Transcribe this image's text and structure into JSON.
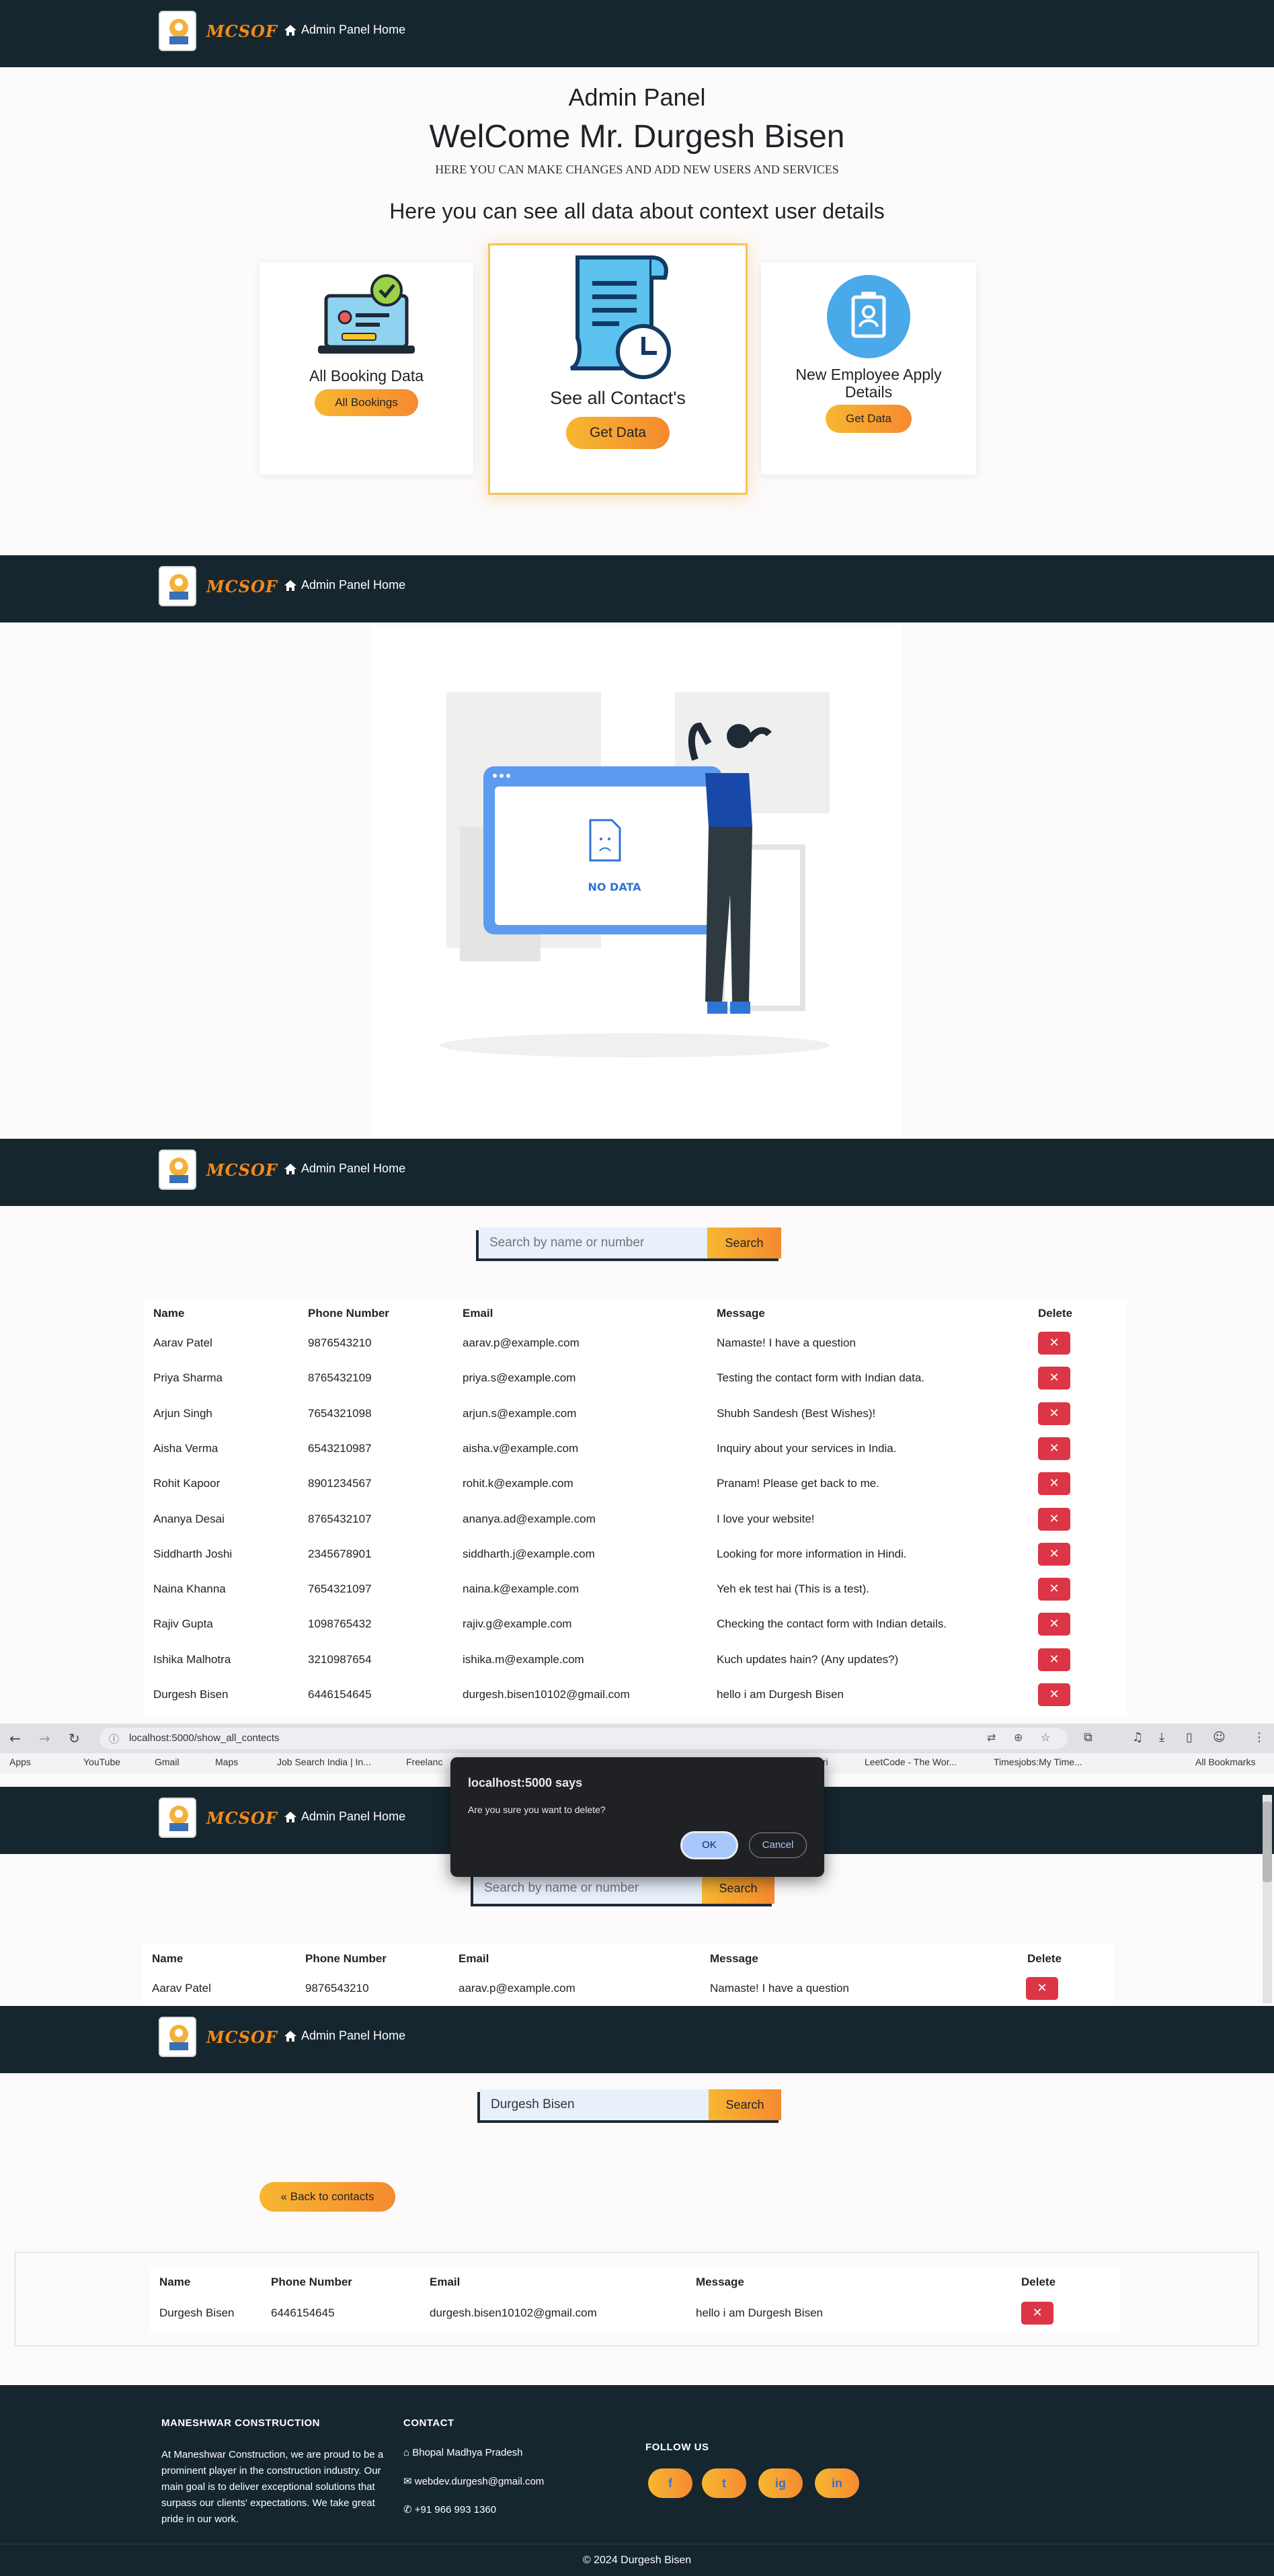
{
  "brand": "MCSOF",
  "nav_home": "Admin Panel Home",
  "admin": {
    "title": "Admin Panel",
    "welcome": "WelCome Mr. Durgesh Bisen",
    "subtitle": "HERE YOU CAN MAKE CHANGES AND ADD NEW USERS AND SERVICES",
    "context_heading": "Here you can see all data about context user details",
    "cards": [
      {
        "title": "All Booking Data",
        "button": "All Bookings"
      },
      {
        "title": "See all Contact's",
        "button": "Get Data"
      },
      {
        "title": "New Employee Apply Details",
        "button": "Get Data"
      }
    ]
  },
  "no_data": {
    "label": "NO DATA"
  },
  "search": {
    "placeholder": "Search by name or number",
    "button": "Search",
    "typed_value": "Durgesh Bisen"
  },
  "table": {
    "headers": [
      "Name",
      "Phone Number",
      "Email",
      "Message",
      "Delete"
    ],
    "delete_icon": "x-icon",
    "rows": [
      {
        "name": "Aarav Patel",
        "phone": "9876543210",
        "email": "aarav.p@example.com",
        "message": "Namaste! I have a question"
      },
      {
        "name": "Priya Sharma",
        "phone": "8765432109",
        "email": "priya.s@example.com",
        "message": "Testing the contact form with Indian data."
      },
      {
        "name": "Arjun Singh",
        "phone": "7654321098",
        "email": "arjun.s@example.com",
        "message": "Shubh Sandesh (Best Wishes)!"
      },
      {
        "name": "Aisha Verma",
        "phone": "6543210987",
        "email": "aisha.v@example.com",
        "message": "Inquiry about your services in India."
      },
      {
        "name": "Rohit Kapoor",
        "phone": "8901234567",
        "email": "rohit.k@example.com",
        "message": "Pranam! Please get back to me."
      },
      {
        "name": "Ananya Desai",
        "phone": "8765432107",
        "email": "ananya.ad@example.com",
        "message": "I love your website!"
      },
      {
        "name": "Siddharth Joshi",
        "phone": "2345678901",
        "email": "siddharth.j@example.com",
        "message": "Looking for more information in Hindi."
      },
      {
        "name": "Naina Khanna",
        "phone": "7654321097",
        "email": "naina.k@example.com",
        "message": "Yeh ek test hai (This is a test)."
      },
      {
        "name": "Rajiv Gupta",
        "phone": "1098765432",
        "email": "rajiv.g@example.com",
        "message": "Checking the contact form with Indian details."
      },
      {
        "name": "Ishika Malhotra",
        "phone": "3210987654",
        "email": "ishika.m@example.com",
        "message": "Kuch updates hain? (Any updates?)"
      },
      {
        "name": "Durgesh Bisen",
        "phone": "6446154645",
        "email": "durgesh.bisen10102@gmail.com",
        "message": "hello i am Durgesh Bisen"
      }
    ]
  },
  "browser": {
    "url": "localhost:5000/show_all_contects",
    "bookmarks": [
      "Apps",
      "YouTube",
      "Gmail",
      "Maps",
      "Job Search India | In...",
      "Freelanc",
      "ri",
      "LeetCode - The Wor...",
      "Timesjobs:My Time...",
      "All Bookmarks"
    ]
  },
  "dialog": {
    "title": "localhost:5000 says",
    "message": "Are you sure you want to delete?",
    "ok": "OK",
    "cancel": "Cancel"
  },
  "back_button": "« Back to contacts",
  "footer": {
    "company_heading": "MANESHWAR CONSTRUCTION",
    "company_text": "At Maneshwar Construction, we are proud to be a prominent player in the construction industry. Our main goal is to deliver exceptional solutions that surpass our clients' expectations. We take great pride in our work.",
    "contact_heading": "CONTACT",
    "address": "Bhopal Madhya Pradesh",
    "email": "webdev.durgesh@gmail.com",
    "phone": "+91 966 993 1360",
    "follow_heading": "FOLLOW US",
    "social": [
      "f",
      "t",
      "ig",
      "in"
    ],
    "copyright": "© 2024 Durgesh Bisen"
  },
  "colors": {
    "navy": "#16262f",
    "accent": "#f7b731",
    "danger": "#dc3545"
  }
}
